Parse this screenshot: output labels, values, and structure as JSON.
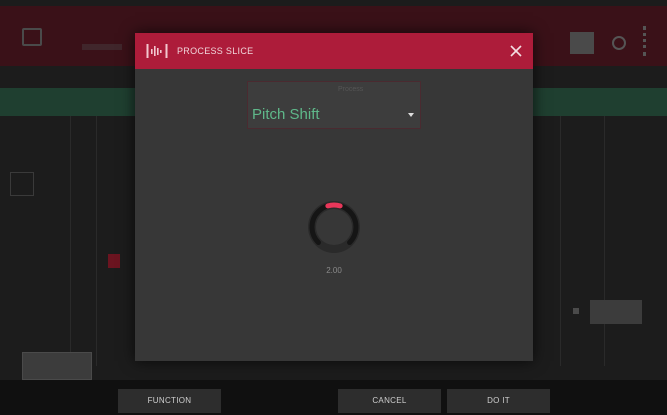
{
  "dialog": {
    "title": "PROCESS SLICE",
    "select_caption": "Process",
    "selected_process": "Pitch Shift",
    "knob": {
      "value_text": "2.00",
      "level_fraction": 0.12,
      "accent_color": "#e8375a"
    }
  },
  "colors": {
    "header": "#ad1c3a",
    "modal_bg": "#373737",
    "select_text": "#5fb88a"
  },
  "bottom_bar": {
    "function_label": "FUNCTION",
    "cancel_label": "CANCEL",
    "do_it_label": "DO IT"
  },
  "icons": {
    "header": "waveform-slice-icon",
    "close": "close-icon",
    "dropdown": "caret-down-icon"
  }
}
